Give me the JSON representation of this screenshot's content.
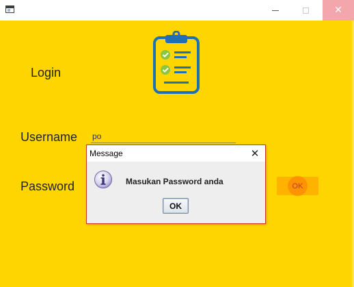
{
  "window": {
    "title": "",
    "minimize_glyph": "",
    "maximize_glyph": "",
    "close_glyph": "✕"
  },
  "login": {
    "heading": "Login",
    "username_label": "Username",
    "username_value": "po",
    "password_label": "Password",
    "ok_button": "OK"
  },
  "dialog": {
    "title": "Message",
    "close_glyph": "✕",
    "message": "Masukan Password anda",
    "ok_button": "OK"
  },
  "icons": {
    "clipboard": "clipboard-checklist-icon",
    "info": "info-icon"
  },
  "colors": {
    "background": "#FFD500",
    "ok_button": "#FFB300",
    "icon_blue": "#1F6FB5",
    "check_green": "#8CC63F"
  }
}
